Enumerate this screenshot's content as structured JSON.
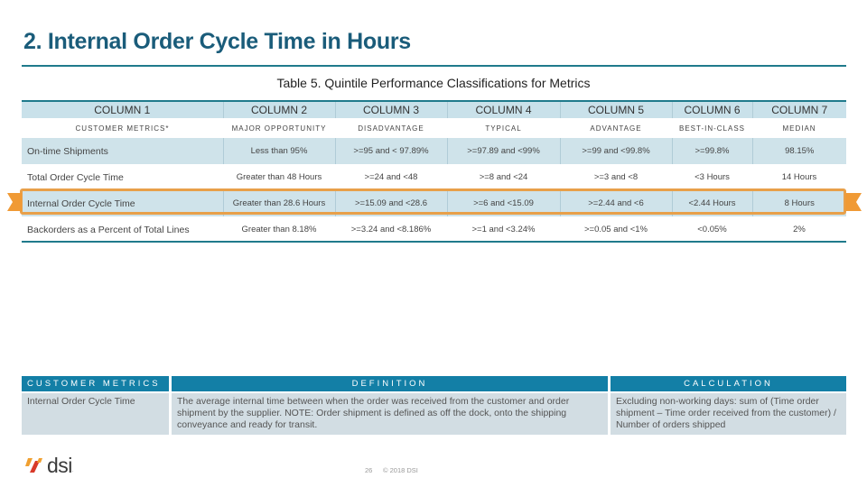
{
  "title": "2. Internal Order Cycle Time in Hours",
  "caption": "Table 5. Quintile Performance Classifications for Metrics",
  "performance_table": {
    "headers": [
      "COLUMN 1",
      "COLUMN 2",
      "COLUMN 3",
      "COLUMN 4",
      "COLUMN 5",
      "COLUMN 6",
      "COLUMN 7"
    ],
    "subheaders": [
      "CUSTOMER METRICS*",
      "MAJOR OPPORTUNITY",
      "DISADVANTAGE",
      "TYPICAL",
      "ADVANTAGE",
      "BEST-IN-CLASS",
      "MEDIAN"
    ],
    "rows": [
      [
        "On-time Shipments",
        "Less than 95%",
        ">=95 and < 97.89%",
        ">=97.89 and <99%",
        ">=99 and <99.8%",
        ">=99.8%",
        "98.15%"
      ],
      [
        "Total Order Cycle Time",
        "Greater than 48 Hours",
        ">=24 and <48",
        ">=8 and <24",
        ">=3 and <8",
        "<3 Hours",
        "14 Hours"
      ],
      [
        "Internal Order Cycle Time",
        "Greater than 28.6 Hours",
        ">=15.09 and <28.6",
        ">=6 and <15.09",
        ">=2.44 and <6",
        "<2.44 Hours",
        "8 Hours"
      ],
      [
        "Backorders as a Percent of Total Lines",
        "Greater than 8.18%",
        ">=3.24 and <8.186%",
        ">=1 and <3.24%",
        ">=0.05 and <1%",
        "<0.05%",
        "2%"
      ]
    ],
    "highlighted_row": "Internal Order Cycle Time"
  },
  "definition_table": {
    "headers": [
      "CUSTOMER METRICS",
      "DEFINITION",
      "CALCULATION"
    ],
    "metric": "Internal Order Cycle Time",
    "definition": "The average internal time between when the order was received from the customer and order shipment by the supplier. NOTE: Order shipment is defined as off the dock, onto the shipping conveyance and ready for transit.",
    "calculation": "Excluding non-working days: sum of (Time order shipment – Time order received from the customer) / Number of orders shipped"
  },
  "footer": {
    "logo_text": "dsi",
    "logo_mark": ".",
    "page_number": "26",
    "copyright": "© 2018 DSI"
  },
  "colors": {
    "title": "#1a5c7a",
    "rule": "#1f7a8c",
    "header_bg": "#c9e1ea",
    "highlight": "#e8a04a",
    "def_header_bg": "#137fa6",
    "def_cell_bg": "#d2dde3"
  }
}
